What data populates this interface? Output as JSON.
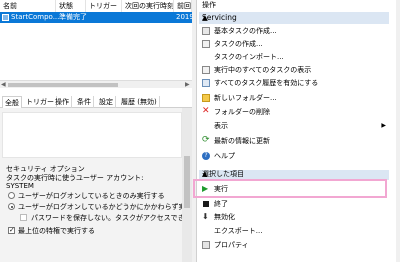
{
  "table": {
    "columns": [
      "名前",
      "状態",
      "トリガー",
      "次回の実行時刻",
      "前回の"
    ],
    "rows": [
      {
        "name": "StartCompo...",
        "status": "準備完了",
        "trigger": "",
        "next_run": "",
        "last_run": "2019/"
      }
    ]
  },
  "tabs": [
    "全般",
    "トリガー",
    "操作",
    "条件",
    "設定",
    "履歴 (無効)"
  ],
  "general": {
    "security_options_label": "セキュリティ オプション",
    "run_as_label": "タスクの実行時に使うユーザー アカウント:",
    "run_as_user": "SYSTEM",
    "radio_logged_on": "ユーザーがログオンしているときのみ実行する",
    "radio_any": "ユーザーがログオンしているかどうかにかかわらず実行する",
    "no_password": "パスワードを保存しない。タスクがアクセスできるのはロー",
    "highest_privileges": "最上位の特権で実行する"
  },
  "actions_pane": {
    "title": "操作",
    "section_title": "Servicing",
    "items": [
      {
        "label": "基本タスクの作成...",
        "icon": "create-basic-task-icon"
      },
      {
        "label": "タスクの作成...",
        "icon": "create-task-icon"
      },
      {
        "label": "タスクのインポート...",
        "icon": ""
      },
      {
        "label": "実行中のすべてのタスクの表示",
        "icon": "running-tasks-icon"
      },
      {
        "label": "すべてのタスク履歴を有効にする",
        "icon": "task-history-icon"
      },
      {
        "label": "新しいフォルダー...",
        "icon": "folder-icon"
      },
      {
        "label": "フォルダーの削除",
        "icon": "delete-x-icon"
      },
      {
        "label": "表示",
        "icon": "",
        "submenu": "▶"
      },
      {
        "label": "最新の情報に更新",
        "icon": "refresh-icon"
      },
      {
        "label": "ヘルプ",
        "icon": "help-icon"
      }
    ],
    "selected_section_title": "選択した項目",
    "selected_items": [
      {
        "label": "実行",
        "icon": "run-play-icon"
      },
      {
        "label": "終了",
        "icon": "end-stop-icon"
      },
      {
        "label": "無効化",
        "icon": "disable-icon"
      },
      {
        "label": "エクスポート...",
        "icon": ""
      },
      {
        "label": "プロパティ",
        "icon": "properties-icon"
      }
    ]
  },
  "colors": {
    "selection": "#0a78d7",
    "section_header": "#dbe6f3",
    "highlight_border": "#f2a7d2"
  }
}
